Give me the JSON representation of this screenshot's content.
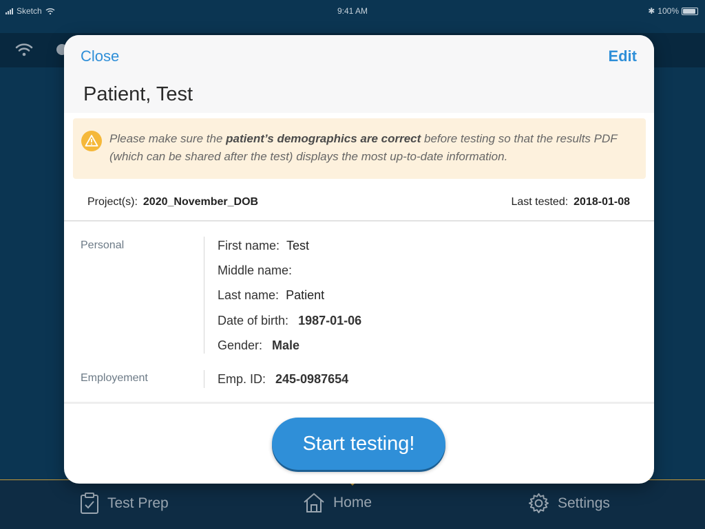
{
  "status_bar": {
    "carrier": "Sketch",
    "time": "9:41 AM",
    "battery": "100%"
  },
  "modal": {
    "close_label": "Close",
    "edit_label": "Edit",
    "title": "Patient, Test",
    "warning": {
      "pre": "Please make sure the ",
      "bold": "patient’s demographics are correct",
      "post": " before testing so that the results PDF (which can be shared after the test) displays the most up-to-date information."
    },
    "projects_label": "Project(s):",
    "projects_value": "2020_November_DOB",
    "last_tested_label": "Last tested:",
    "last_tested_value": "2018-01-08",
    "sections": {
      "personal_label": "Personal",
      "employment_label": "Employement"
    },
    "fields": {
      "first_name_label": "First name:",
      "first_name_value": "Test",
      "middle_name_label": "Middle name:",
      "middle_name_value": "",
      "last_name_label": "Last name:",
      "last_name_value": "Patient",
      "dob_label": "Date of birth:",
      "dob_value": "1987-01-06",
      "gender_label": "Gender:",
      "gender_value": "Male",
      "emp_id_label": "Emp. ID:",
      "emp_id_value": "245-0987654"
    },
    "start_button": "Start testing!"
  },
  "tab_bar": {
    "items": [
      {
        "label": "Test Prep",
        "icon": "clipboard-check-icon"
      },
      {
        "label": "Home",
        "icon": "home-icon"
      },
      {
        "label": "Settings",
        "icon": "gear-icon"
      }
    ],
    "active": "Home"
  },
  "colors": {
    "background": "#0b3552",
    "accent": "#2f8fd8",
    "warning_bg": "#fdf1dd",
    "warning_icon": "#f5b83a",
    "tab_indicator": "#c79a38"
  }
}
